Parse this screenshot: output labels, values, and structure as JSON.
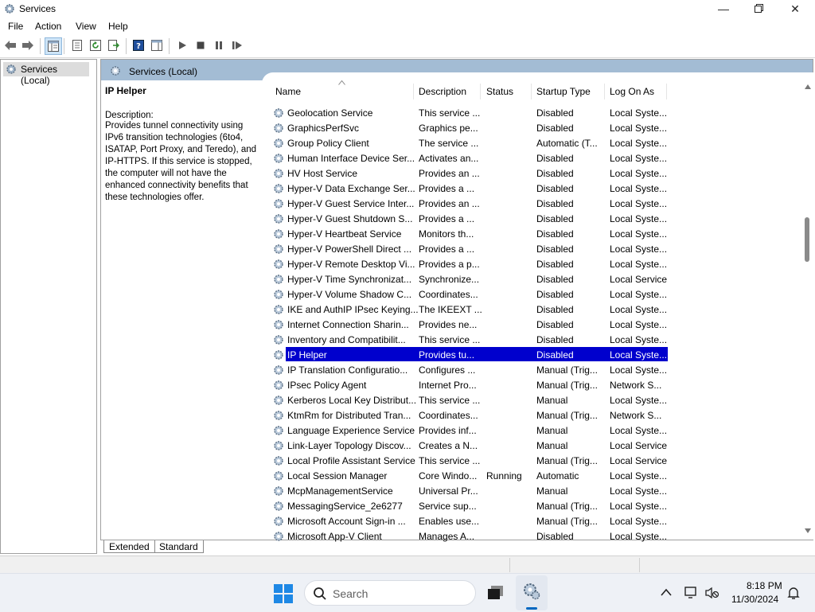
{
  "window": {
    "title": "Services"
  },
  "menu": [
    "File",
    "Action",
    "View",
    "Help"
  ],
  "tree": {
    "root": "Services (Local)"
  },
  "main_header": "Services (Local)",
  "details": {
    "title": "IP Helper",
    "desc_label": "Description:",
    "desc_lines": [
      "Provides tunnel connectivity using",
      "IPv6 transition technologies (6to4,",
      "ISATAP, Port Proxy, and Teredo), and",
      "IP-HTTPS. If this service is stopped,",
      "the computer will not have the",
      "enhanced connectivity benefits that",
      "these technologies offer."
    ]
  },
  "columns": [
    "Name",
    "Description",
    "Status",
    "Startup Type",
    "Log On As"
  ],
  "services": [
    {
      "name": "Geolocation Service",
      "description": "This service ...",
      "status": "",
      "startup": "Disabled",
      "logon": "Local Syste..."
    },
    {
      "name": "GraphicsPerfSvc",
      "description": "Graphics pe...",
      "status": "",
      "startup": "Disabled",
      "logon": "Local Syste..."
    },
    {
      "name": "Group Policy Client",
      "description": "The service ...",
      "status": "",
      "startup": "Automatic (T...",
      "logon": "Local Syste..."
    },
    {
      "name": "Human Interface Device Ser...",
      "description": "Activates an...",
      "status": "",
      "startup": "Disabled",
      "logon": "Local Syste..."
    },
    {
      "name": "HV Host Service",
      "description": "Provides an ...",
      "status": "",
      "startup": "Disabled",
      "logon": "Local Syste..."
    },
    {
      "name": "Hyper-V Data Exchange Ser...",
      "description": "Provides a ...",
      "status": "",
      "startup": "Disabled",
      "logon": "Local Syste..."
    },
    {
      "name": "Hyper-V Guest Service Inter...",
      "description": "Provides an ...",
      "status": "",
      "startup": "Disabled",
      "logon": "Local Syste..."
    },
    {
      "name": "Hyper-V Guest Shutdown S...",
      "description": "Provides a ...",
      "status": "",
      "startup": "Disabled",
      "logon": "Local Syste..."
    },
    {
      "name": "Hyper-V Heartbeat Service",
      "description": "Monitors th...",
      "status": "",
      "startup": "Disabled",
      "logon": "Local Syste..."
    },
    {
      "name": "Hyper-V PowerShell Direct ...",
      "description": "Provides a ...",
      "status": "",
      "startup": "Disabled",
      "logon": "Local Syste..."
    },
    {
      "name": "Hyper-V Remote Desktop Vi...",
      "description": "Provides a p...",
      "status": "",
      "startup": "Disabled",
      "logon": "Local Syste..."
    },
    {
      "name": "Hyper-V Time Synchronizat...",
      "description": "Synchronize...",
      "status": "",
      "startup": "Disabled",
      "logon": "Local Service"
    },
    {
      "name": "Hyper-V Volume Shadow C...",
      "description": "Coordinates...",
      "status": "",
      "startup": "Disabled",
      "logon": "Local Syste..."
    },
    {
      "name": "IKE and AuthIP IPsec Keying...",
      "description": "The IKEEXT ...",
      "status": "",
      "startup": "Disabled",
      "logon": "Local Syste..."
    },
    {
      "name": "Internet Connection Sharin...",
      "description": "Provides ne...",
      "status": "",
      "startup": "Disabled",
      "logon": "Local Syste..."
    },
    {
      "name": "Inventory and Compatibilit...",
      "description": "This service ...",
      "status": "",
      "startup": "Disabled",
      "logon": "Local Syste..."
    },
    {
      "name": "IP Helper",
      "description": "Provides tu...",
      "status": "",
      "startup": "Disabled",
      "logon": "Local Syste...",
      "selected": true
    },
    {
      "name": "IP Translation Configuratio...",
      "description": "Configures ...",
      "status": "",
      "startup": "Manual (Trig...",
      "logon": "Local Syste..."
    },
    {
      "name": "IPsec Policy Agent",
      "description": "Internet Pro...",
      "status": "",
      "startup": "Manual (Trig...",
      "logon": "Network S..."
    },
    {
      "name": "Kerberos Local Key Distribut...",
      "description": "This service ...",
      "status": "",
      "startup": "Manual",
      "logon": "Local Syste..."
    },
    {
      "name": "KtmRm for Distributed Tran...",
      "description": "Coordinates...",
      "status": "",
      "startup": "Manual (Trig...",
      "logon": "Network S..."
    },
    {
      "name": "Language Experience Service",
      "description": "Provides inf...",
      "status": "",
      "startup": "Manual",
      "logon": "Local Syste..."
    },
    {
      "name": "Link-Layer Topology Discov...",
      "description": "Creates a N...",
      "status": "",
      "startup": "Manual",
      "logon": "Local Service"
    },
    {
      "name": "Local Profile Assistant Service",
      "description": "This service ...",
      "status": "",
      "startup": "Manual (Trig...",
      "logon": "Local Service"
    },
    {
      "name": "Local Session Manager",
      "description": "Core Windo...",
      "status": "Running",
      "startup": "Automatic",
      "logon": "Local Syste..."
    },
    {
      "name": "McpManagementService",
      "description": "Universal Pr...",
      "status": "",
      "startup": "Manual",
      "logon": "Local Syste..."
    },
    {
      "name": "MessagingService_2e6277",
      "description": "Service sup...",
      "status": "",
      "startup": "Manual (Trig...",
      "logon": "Local Syste..."
    },
    {
      "name": "Microsoft Account Sign-in ...",
      "description": "Enables use...",
      "status": "",
      "startup": "Manual (Trig...",
      "logon": "Local Syste..."
    },
    {
      "name": "Microsoft App-V Client",
      "description": "Manages A...",
      "status": "",
      "startup": "Disabled",
      "logon": "Local Syste..."
    }
  ],
  "tabs": [
    "Extended",
    "Standard"
  ],
  "taskbar": {
    "search_placeholder": "Search",
    "time": "8:18 PM",
    "date": "11/30/2024"
  },
  "colors": {
    "selection": "#0000cd",
    "header_band": "#a3bcd4"
  }
}
